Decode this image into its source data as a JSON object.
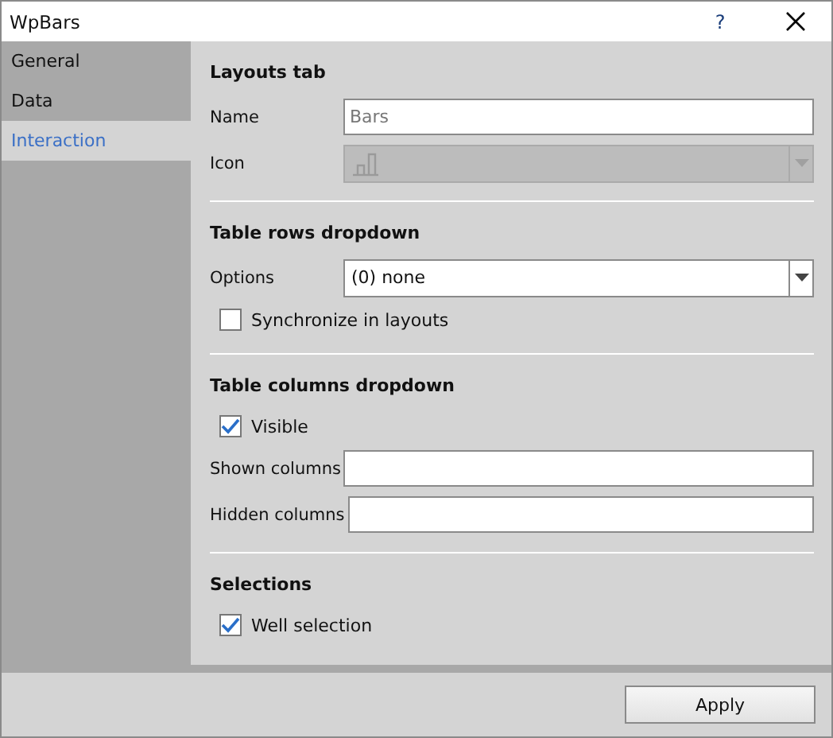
{
  "window": {
    "title": "WpBars",
    "help": "?"
  },
  "sidebar": {
    "items": [
      {
        "label": "General",
        "selected": false
      },
      {
        "label": "Data",
        "selected": false
      },
      {
        "label": "Interaction",
        "selected": true
      }
    ]
  },
  "sections": [
    {
      "title": "Layouts tab",
      "rows": [
        {
          "kind": "text",
          "label": "Name",
          "placeholder": "Bars"
        },
        {
          "kind": "select",
          "label": "Icon",
          "disabled": true
        }
      ]
    },
    {
      "title": "Table rows dropdown",
      "rows": [
        {
          "kind": "select",
          "label": "Options",
          "value": "(0) none",
          "disabled": false
        },
        {
          "kind": "checkbox",
          "label": "Synchronize in layouts",
          "checked": false
        }
      ]
    },
    {
      "title": "Table columns dropdown",
      "rows": [
        {
          "kind": "checkbox",
          "label": "Visible",
          "checked": true
        },
        {
          "kind": "text",
          "label": "Shown columns"
        },
        {
          "kind": "text",
          "label": "Hidden columns"
        }
      ]
    },
    {
      "title": "Selections",
      "rows": [
        {
          "kind": "checkbox",
          "label": "Well selection",
          "checked": true
        }
      ]
    }
  ],
  "buttons": [
    "Apply"
  ]
}
